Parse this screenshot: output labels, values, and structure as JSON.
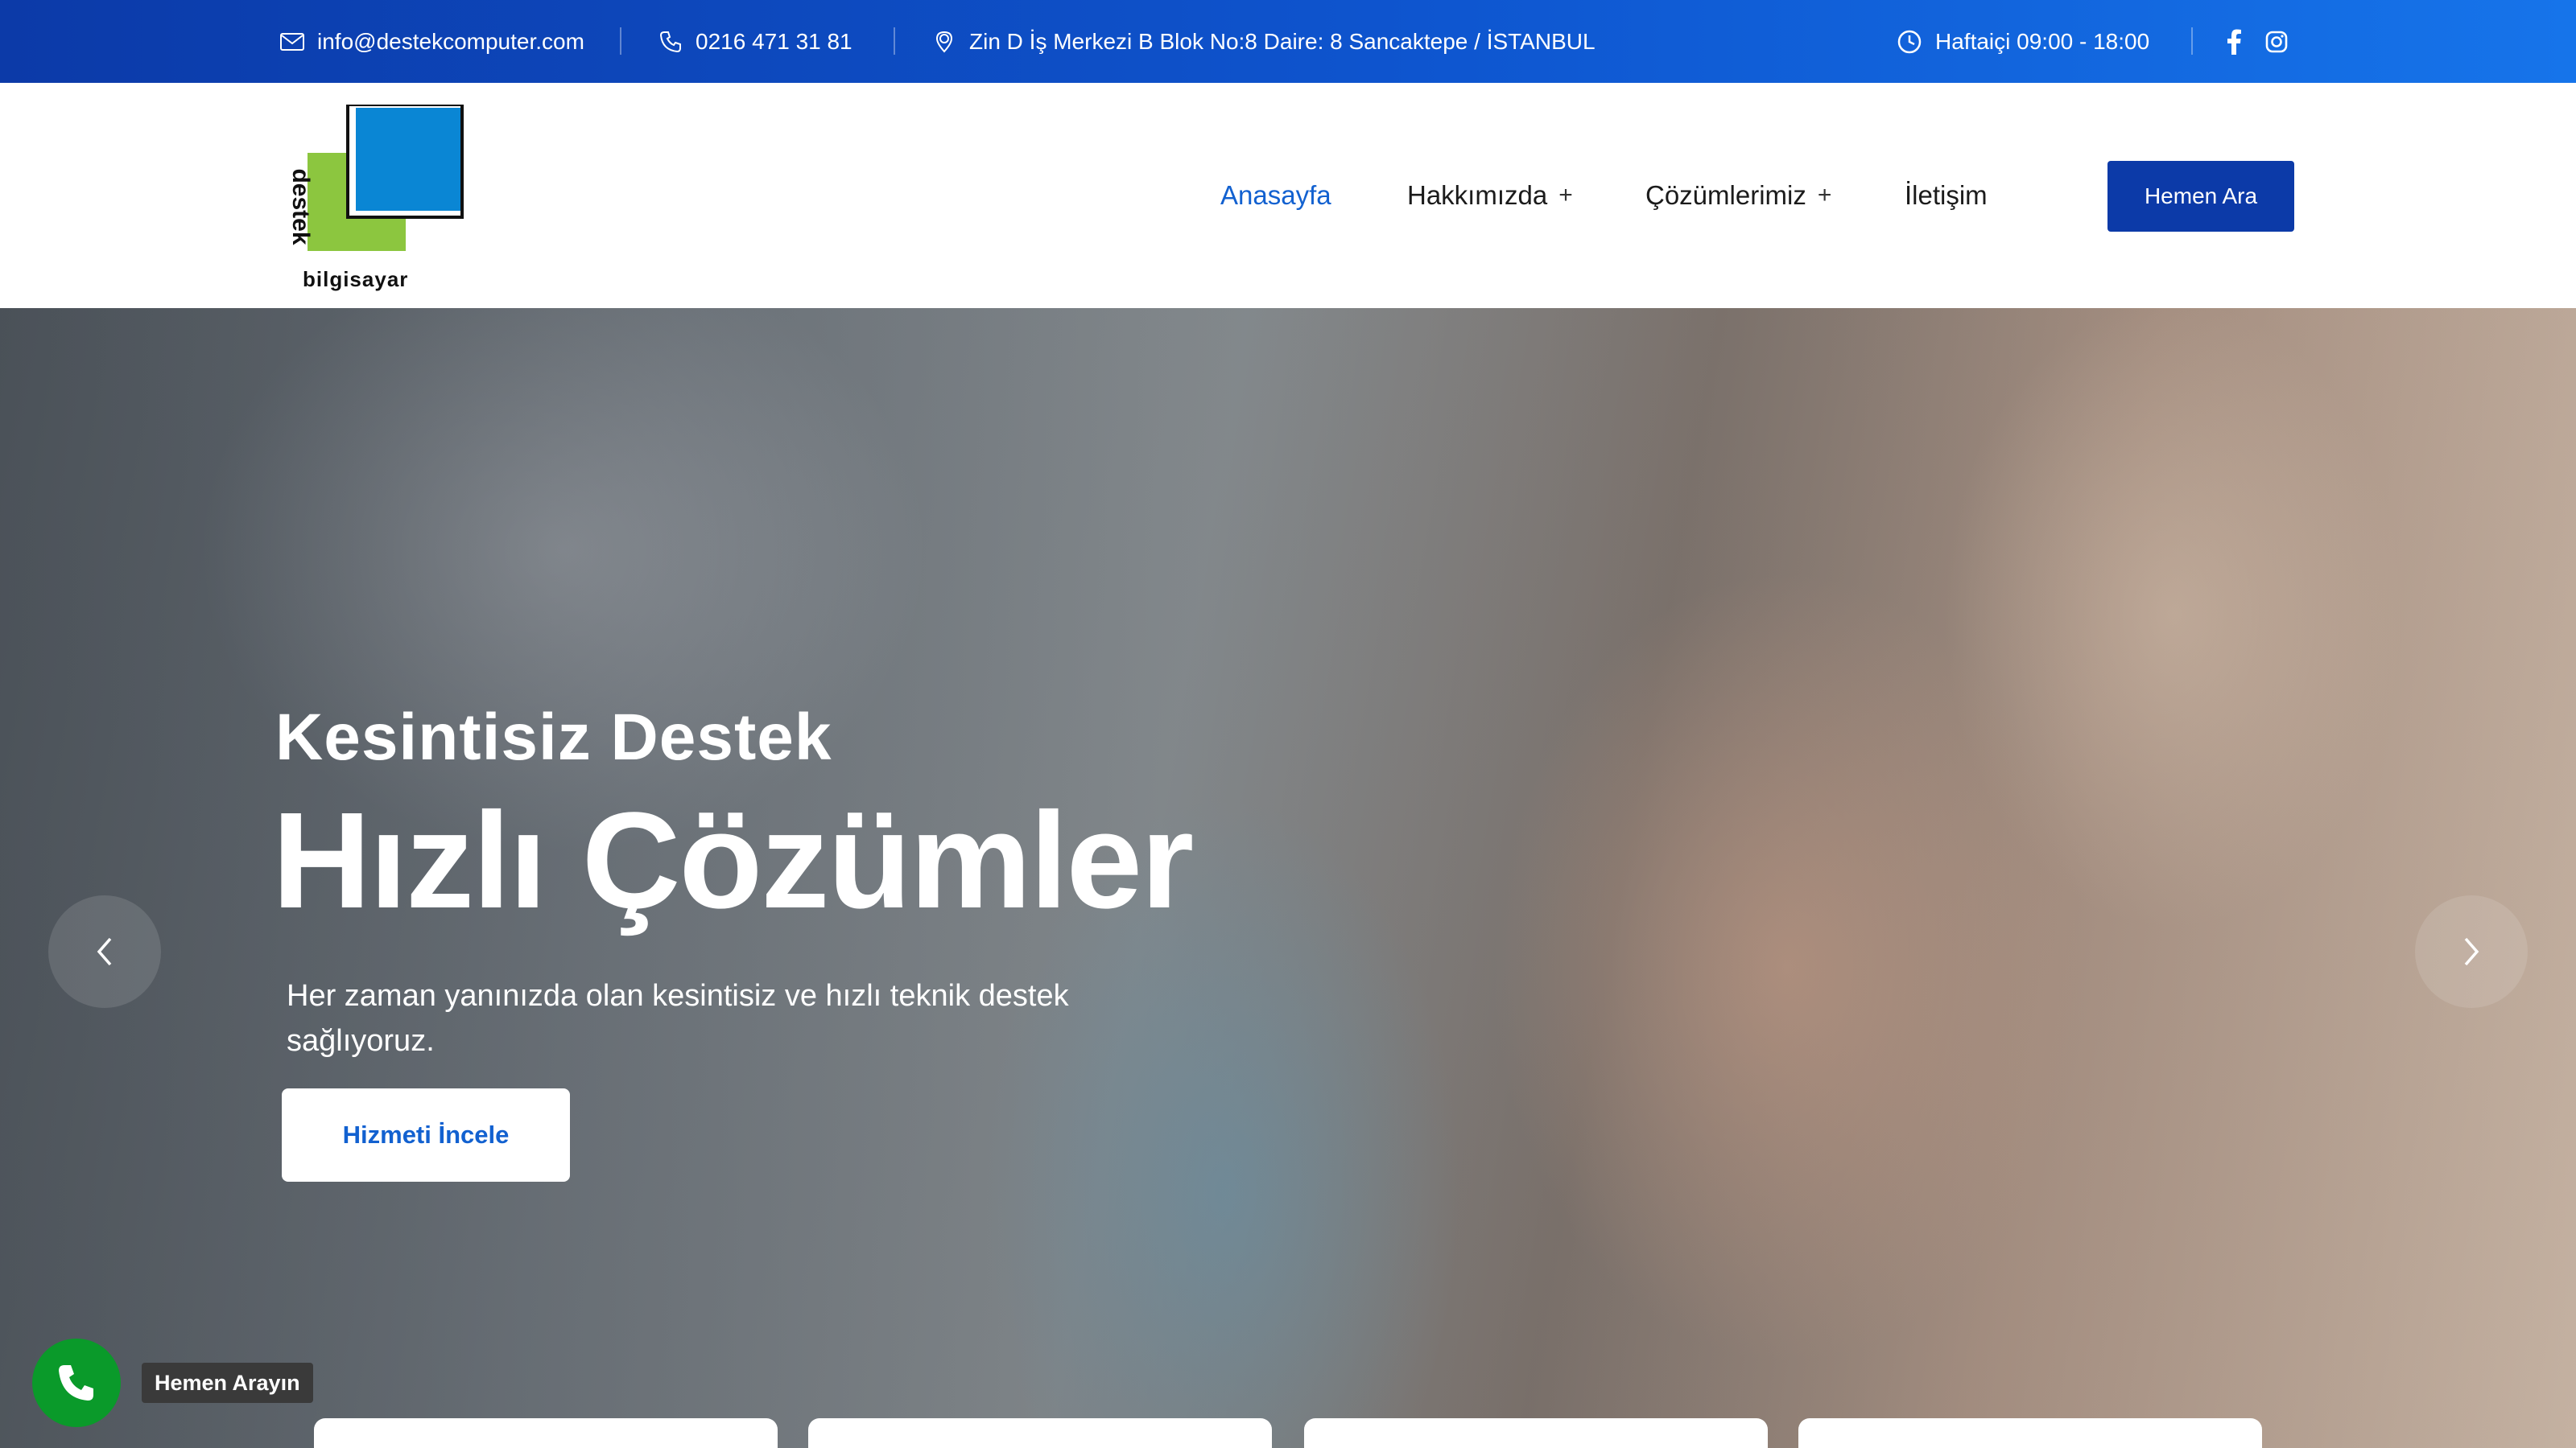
{
  "topbar": {
    "email": "info@destekcomputer.com",
    "phone": "0216 471 31 81",
    "address": "Zin D İş Merkezi B Blok No:8 Daire: 8 Sancaktepe / İSTANBUL",
    "hours": "Haftaiçi 09:00 - 18:00",
    "social": [
      "facebook-icon",
      "instagram-icon"
    ]
  },
  "logo": {
    "vertical_text": "destek",
    "bottom_text": "bilgisayar",
    "colors": {
      "blue": "#0a86d4",
      "green": "#8cc63f"
    }
  },
  "nav": {
    "items": [
      {
        "label": "Anasayfa",
        "active": true,
        "has_submenu": false
      },
      {
        "label": "Hakkımızda",
        "active": false,
        "has_submenu": true
      },
      {
        "label": "Çözümlerimiz",
        "active": false,
        "has_submenu": true
      },
      {
        "label": "İletişim",
        "active": false,
        "has_submenu": false
      }
    ],
    "plus": "+",
    "cta_label": "Hemen Ara"
  },
  "hero": {
    "subtitle": "Kesintisiz Destek",
    "title": "Hızlı Çözümler",
    "description": "Her zaman yanınızda olan kesintisiz ve hızlı teknik destek sağlıyoruz.",
    "button_label": "Hizmeti İncele"
  },
  "call_widget": {
    "label": "Hemen Arayın",
    "color": "#0a9a2a"
  },
  "colors": {
    "topbar_start": "#0c3aa8",
    "topbar_end": "#1674ea",
    "accent": "#1261d0",
    "cta_bg": "#0c3aa8"
  }
}
